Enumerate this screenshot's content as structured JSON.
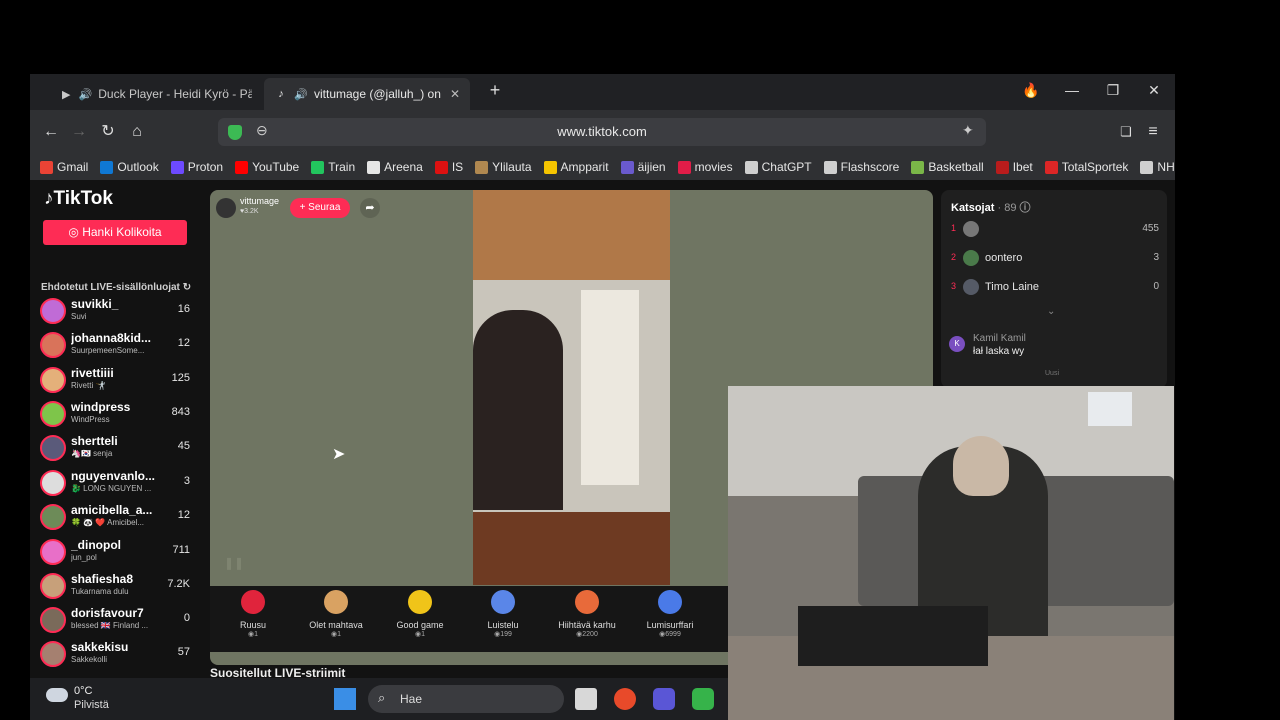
{
  "tabs": [
    {
      "title": "Duck Player - Heidi Kyrö - Päivä",
      "icon": "duck-player-icon"
    },
    {
      "title": "vittumage (@jalluh_) on LIV",
      "icon": "tiktok-icon",
      "active": true
    }
  ],
  "address": {
    "url": "www.tiktok.com"
  },
  "bookmarks": [
    {
      "label": "Gmail",
      "color": "#ea4335"
    },
    {
      "label": "Outlook",
      "color": "#0f78d4"
    },
    {
      "label": "Proton",
      "color": "#6d4aff"
    },
    {
      "label": "YouTube",
      "color": "#ff0000"
    },
    {
      "label": "Train",
      "color": "#22c55e"
    },
    {
      "label": "Areena",
      "color": "#e6e6e6"
    },
    {
      "label": "IS",
      "color": "#d11"
    },
    {
      "label": "Ylilauta",
      "color": "#b08850"
    },
    {
      "label": "Ampparit",
      "color": "#f5c400"
    },
    {
      "label": "äijien",
      "color": "#6a5acd"
    },
    {
      "label": "movies",
      "color": "#e11d48"
    },
    {
      "label": "ChatGPT",
      "color": "#cfcfcf"
    },
    {
      "label": "Flashscore",
      "color": "#cfcfcf"
    },
    {
      "label": "Basketball",
      "color": "#7ab648"
    },
    {
      "label": "Ibet",
      "color": "#b91c1c"
    },
    {
      "label": "TotalSportek",
      "color": "#dc2626"
    },
    {
      "label": "NHL",
      "color": "#cfcfcf"
    }
  ],
  "tiktok": {
    "logo": "TikTok",
    "coins_button": "Hanki Kolikoita",
    "suggested_heading": "Ehdotetut LIVE-sisällönluojat",
    "creators": [
      {
        "name": "suvikki_",
        "sub": "Suvi",
        "count": "16",
        "color": "#c06bd6"
      },
      {
        "name": "johanna8kid...",
        "sub": "SuurpemeenSome...",
        "count": "12",
        "color": "#d9735a"
      },
      {
        "name": "rivettiiii",
        "sub": "Rivetti 🤺",
        "count": "125",
        "color": "#e4b07a"
      },
      {
        "name": "windpress",
        "sub": "WindPress",
        "count": "843",
        "color": "#7ec54a"
      },
      {
        "name": "shertteli",
        "sub": "🦄🇰🇷 senja",
        "count": "45",
        "color": "#5a5a7a"
      },
      {
        "name": "nguyenvanlo...",
        "sub": "🐉 LONG NGUYEN ...",
        "count": "3",
        "color": "#dddddd"
      },
      {
        "name": "amicibella_a...",
        "sub": "🍀 🐼 ❤️ Amicibel...",
        "count": "12",
        "color": "#6d8b58"
      },
      {
        "name": "_dinopol",
        "sub": "jun_pol",
        "count": "711",
        "color": "#e86fc8"
      },
      {
        "name": "shafiesha8",
        "sub": "Tukarnama dulu",
        "count": "7.2K",
        "color": "#c7a07a"
      },
      {
        "name": "dorisfavour7",
        "sub": "blessed 🇬🇧 Finland ...",
        "count": "0",
        "color": "#7a6a5a"
      },
      {
        "name": "sakkekisu",
        "sub": "Sakkekolli",
        "count": "57",
        "color": "#a58070"
      }
    ],
    "host": {
      "name": "vittumage",
      "likes": "3.2K",
      "follow_label": "+ Seuraa"
    },
    "gifts": [
      {
        "label": "Ruusu",
        "price": "1",
        "color": "#e0243c"
      },
      {
        "label": "Olet mahtava",
        "price": "1",
        "color": "#d9a262"
      },
      {
        "label": "Good game",
        "price": "1",
        "color": "#f0c419"
      },
      {
        "label": "Luistelu",
        "price": "199",
        "color": "#5a86e8"
      },
      {
        "label": "Hiihtävä karhu",
        "price": "2200",
        "color": "#e86a3a"
      },
      {
        "label": "Lumisurffari",
        "price": "6999",
        "color": "#4a7ae8"
      }
    ],
    "recommended_heading": "Suositellut LIVE-striimit",
    "viewers": {
      "title": "Katsojat",
      "count": "89",
      "rows": [
        {
          "rank": "1",
          "name": "",
          "score": "455"
        },
        {
          "rank": "2",
          "name": "oontero",
          "score": "3"
        },
        {
          "rank": "3",
          "name": "Timo Laine",
          "score": "0"
        }
      ],
      "chat_user": "Kamil Kamil",
      "chat_text": "łał laska wy",
      "new_label": "Uusi"
    }
  },
  "taskbar": {
    "temp": "0°C",
    "weather": "Pilvistä",
    "search_placeholder": "Hae"
  }
}
